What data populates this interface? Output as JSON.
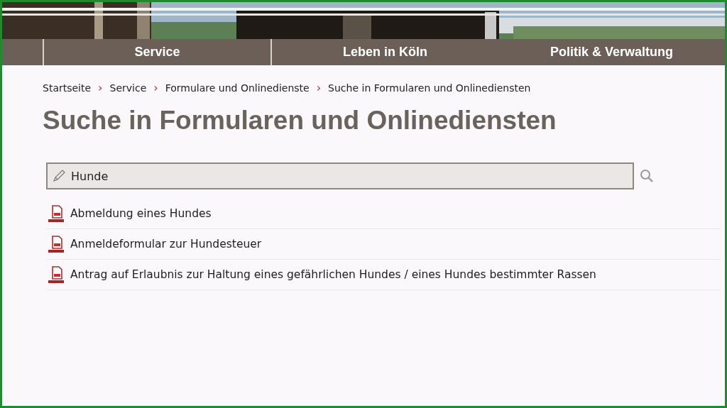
{
  "navigation": [
    {
      "label": "Service"
    },
    {
      "label": "Leben in Köln"
    },
    {
      "label": "Politik & Verwaltung"
    }
  ],
  "breadcrumb": [
    {
      "label": "Startseite"
    },
    {
      "label": "Service"
    },
    {
      "label": "Formulare und Onlinedienste"
    },
    {
      "label": "Suche in Formularen und Onlinediensten"
    }
  ],
  "breadcrumb_separator": "›",
  "title": "Suche in Formularen und Onlinediensten",
  "search": {
    "value": "Hunde"
  },
  "results": [
    {
      "title": "Abmeldung eines Hundes"
    },
    {
      "title": "Anmeldeformular zur Hundesteuer"
    },
    {
      "title": "Antrag auf Erlaubnis zur Haltung eines gefährlichen Hundes / eines Hundes bestimmter Rassen"
    }
  ]
}
